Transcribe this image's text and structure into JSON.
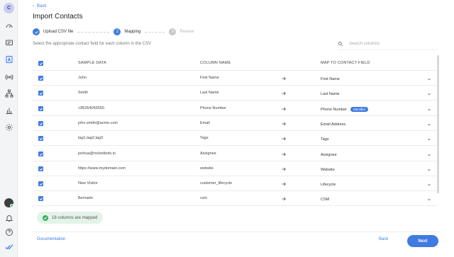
{
  "sidebar": {
    "avatar_initial": "C",
    "icons": [
      "dashboard-icon",
      "chat-icon",
      "contacts-icon",
      "broadcast-icon",
      "workflow-icon",
      "reports-icon",
      "settings-icon"
    ],
    "bottom_icons": [
      "user-avatar",
      "notifications-icon",
      "help-icon",
      "check-double-icon"
    ]
  },
  "header": {
    "back_label": "Back",
    "title": "Import Contacts"
  },
  "stepper": {
    "steps": [
      {
        "number": "1",
        "label": "Upload CSV file",
        "state": "done"
      },
      {
        "number": "2",
        "label": "Mapping",
        "state": "current"
      },
      {
        "number": "3",
        "label": "Review",
        "state": "todo"
      }
    ]
  },
  "subtitle": "Select the appropriate contact field for each column in the CSV",
  "search": {
    "placeholder": "Search columns"
  },
  "table": {
    "headers": {
      "sample": "SAMPLE DATA",
      "column": "COLUMN NAME",
      "map": "MAP TO CONTACT FIELD"
    },
    "rows": [
      {
        "sample": "John",
        "column": "First Name",
        "map": "First Name",
        "badge": ""
      },
      {
        "sample": "Smith",
        "column": "Last Name",
        "map": "Last Name",
        "badge": ""
      },
      {
        "sample": "+85264055550",
        "column": "Phone Number",
        "map": "Phone Number",
        "badge": "Identifier"
      },
      {
        "sample": "john.smith@acme.com",
        "column": "Email",
        "map": "Email Address",
        "badge": ""
      },
      {
        "sample": "tag1,tag2,tag3",
        "column": "Tags",
        "map": "Tags",
        "badge": ""
      },
      {
        "sample": "joshua@rocketbots.io",
        "column": "Assignee",
        "map": "Assignee",
        "badge": ""
      },
      {
        "sample": "https://www.mydomain.com",
        "column": "website",
        "map": "Website",
        "badge": ""
      },
      {
        "sample": "New Visitor",
        "column": "customer_lifecycle",
        "map": "Lifecycle",
        "badge": ""
      },
      {
        "sample": "Bernado",
        "column": "csm",
        "map": "CSM",
        "badge": ""
      }
    ]
  },
  "status": {
    "mapped_text": "18 columns are mapped"
  },
  "footer": {
    "documentation_label": "Documentation",
    "back_label": "Back",
    "next_label": "Next"
  },
  "colors": {
    "accent": "#3f7be0",
    "success": "#34b35a"
  }
}
